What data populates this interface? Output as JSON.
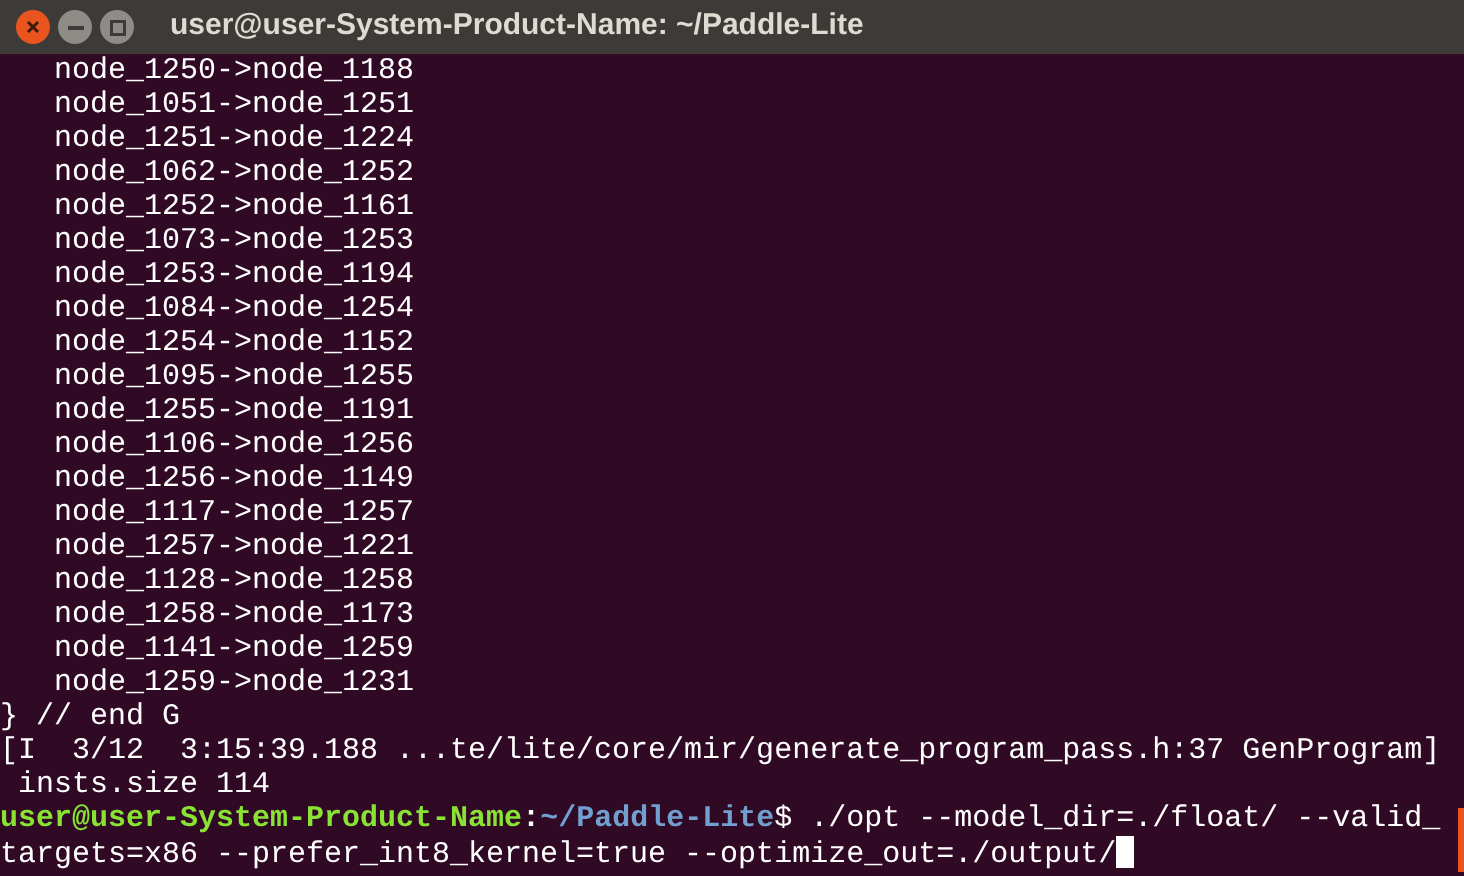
{
  "window": {
    "title": "user@user-System-Product-Name: ~/Paddle-Lite"
  },
  "lines": [
    {
      "kind": "output",
      "text": "   node_1250->node_1188"
    },
    {
      "kind": "output",
      "text": "   node_1051->node_1251"
    },
    {
      "kind": "output",
      "text": "   node_1251->node_1224"
    },
    {
      "kind": "output",
      "text": "   node_1062->node_1252"
    },
    {
      "kind": "output",
      "text": "   node_1252->node_1161"
    },
    {
      "kind": "output",
      "text": "   node_1073->node_1253"
    },
    {
      "kind": "output",
      "text": "   node_1253->node_1194"
    },
    {
      "kind": "output",
      "text": "   node_1084->node_1254"
    },
    {
      "kind": "output",
      "text": "   node_1254->node_1152"
    },
    {
      "kind": "output",
      "text": "   node_1095->node_1255"
    },
    {
      "kind": "output",
      "text": "   node_1255->node_1191"
    },
    {
      "kind": "output",
      "text": "   node_1106->node_1256"
    },
    {
      "kind": "output",
      "text": "   node_1256->node_1149"
    },
    {
      "kind": "output",
      "text": "   node_1117->node_1257"
    },
    {
      "kind": "output",
      "text": "   node_1257->node_1221"
    },
    {
      "kind": "output",
      "text": "   node_1128->node_1258"
    },
    {
      "kind": "output",
      "text": "   node_1258->node_1173"
    },
    {
      "kind": "output",
      "text": "   node_1141->node_1259"
    },
    {
      "kind": "output",
      "text": "   node_1259->node_1231"
    },
    {
      "kind": "output",
      "text": "} // end G"
    },
    {
      "kind": "output",
      "text": "[I  3/12  3:15:39.188 ...te/lite/core/mir/generate_program_pass.h:37 GenProgram]"
    },
    {
      "kind": "output",
      "text": " insts.size 114"
    },
    {
      "kind": "prompt",
      "user_host": "user@user-System-Product-Name",
      "separator": ":",
      "path": "~/Paddle-Lite",
      "symbol": "$",
      "command": " ./opt --model_dir=./float/ --valid_",
      "continuation": "targets=x86 --prefer_int8_kernel=true --optimize_out=./output/"
    }
  ]
}
